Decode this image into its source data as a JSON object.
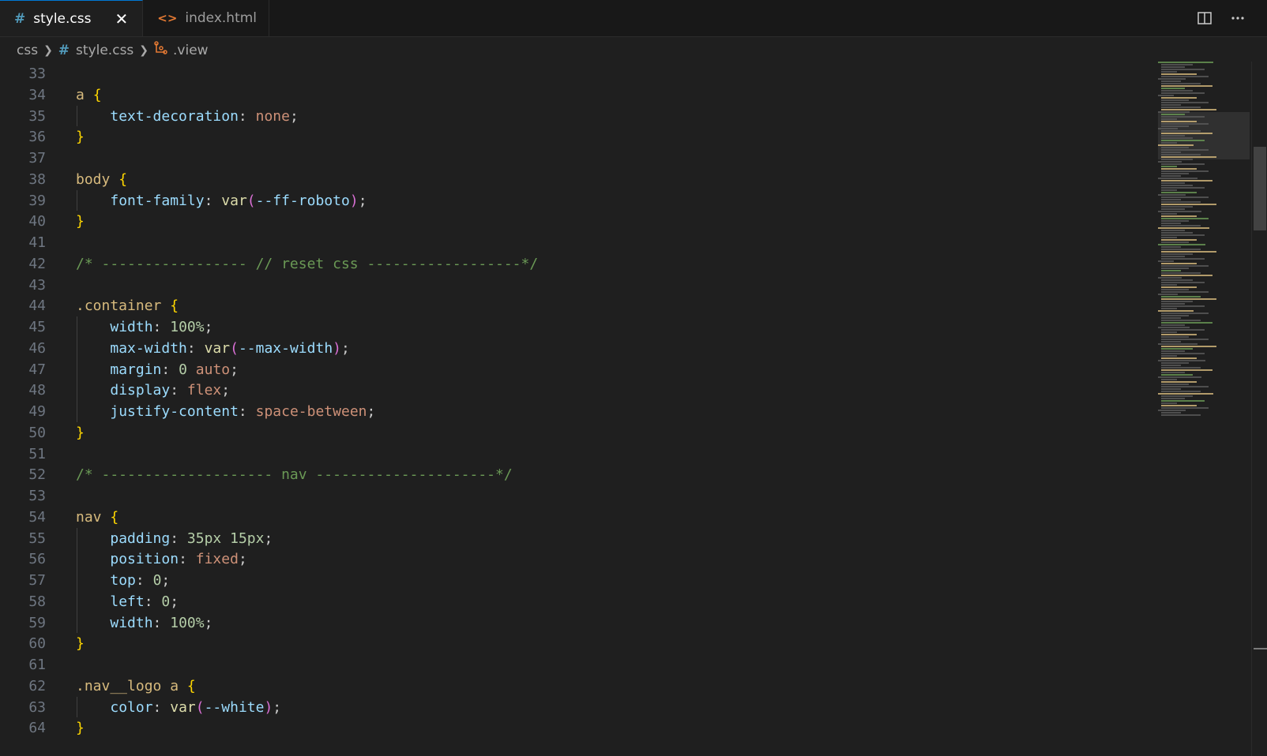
{
  "tabs": [
    {
      "label": "style.css",
      "icon": "css-file-icon",
      "active": true
    },
    {
      "label": "index.html",
      "icon": "html-file-icon",
      "active": false
    }
  ],
  "breadcrumb": {
    "folder": "css",
    "file": "style.css",
    "symbol": ".view"
  },
  "editor": {
    "lines": [
      {
        "num": "33",
        "text": ""
      },
      {
        "num": "34",
        "text": "a {"
      },
      {
        "num": "35",
        "text": "    text-decoration: none;"
      },
      {
        "num": "36",
        "text": "}"
      },
      {
        "num": "37",
        "text": ""
      },
      {
        "num": "38",
        "text": "body {"
      },
      {
        "num": "39",
        "text": "    font-family: var(--ff-roboto);"
      },
      {
        "num": "40",
        "text": "}"
      },
      {
        "num": "41",
        "text": ""
      },
      {
        "num": "42",
        "text": "/* ----------------- // reset css ------------------*/"
      },
      {
        "num": "43",
        "text": ""
      },
      {
        "num": "44",
        "text": ".container {"
      },
      {
        "num": "45",
        "text": "    width: 100%;"
      },
      {
        "num": "46",
        "text": "    max-width: var(--max-width);"
      },
      {
        "num": "47",
        "text": "    margin: 0 auto;"
      },
      {
        "num": "48",
        "text": "    display: flex;"
      },
      {
        "num": "49",
        "text": "    justify-content: space-between;"
      },
      {
        "num": "50",
        "text": "}"
      },
      {
        "num": "51",
        "text": ""
      },
      {
        "num": "52",
        "text": "/* -------------------- nav ---------------------*/"
      },
      {
        "num": "53",
        "text": ""
      },
      {
        "num": "54",
        "text": "nav {"
      },
      {
        "num": "55",
        "text": "    padding: 35px 15px;"
      },
      {
        "num": "56",
        "text": "    position: fixed;"
      },
      {
        "num": "57",
        "text": "    top: 0;"
      },
      {
        "num": "58",
        "text": "    left: 0;"
      },
      {
        "num": "59",
        "text": "    width: 100%;"
      },
      {
        "num": "60",
        "text": "}"
      },
      {
        "num": "61",
        "text": ""
      },
      {
        "num": "62",
        "text": ".nav__logo a {"
      },
      {
        "num": "63",
        "text": "    color: var(--white);"
      },
      {
        "num": "64",
        "text": "}"
      }
    ]
  },
  "colors": {
    "background": "#1f1f1f",
    "selector": "#d7ba7d",
    "brace": "#ffd700",
    "property": "#9cdcfe",
    "value": "#ce9178",
    "number": "#b5cea8",
    "function": "#dcdcaa",
    "comment": "#6a9955",
    "accent": "#0078d4"
  }
}
